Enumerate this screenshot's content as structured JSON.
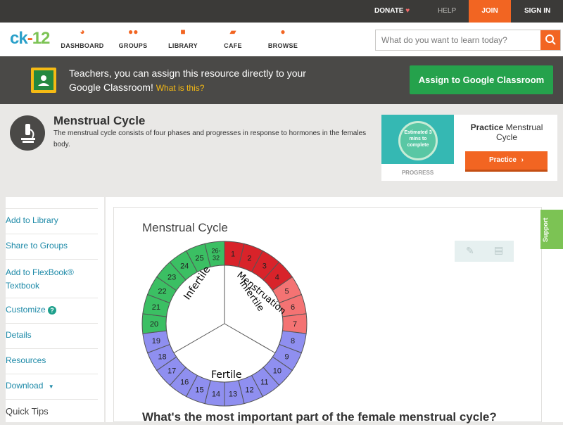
{
  "topbar": {
    "donate": "DONATE",
    "help": "HELP",
    "join": "JOIN",
    "signin": "SIGN IN"
  },
  "logo": {
    "ck": "ck",
    "dash": "-",
    "num": "12"
  },
  "nav": [
    {
      "label": "DASHBOARD",
      "icon": "dashboard-icon"
    },
    {
      "label": "GROUPS",
      "icon": "groups-icon"
    },
    {
      "label": "LIBRARY",
      "icon": "library-icon"
    },
    {
      "label": "CAFE",
      "icon": "cafe-icon"
    },
    {
      "label": "BROWSE",
      "icon": "browse-icon"
    }
  ],
  "search": {
    "placeholder": "What do you want to learn today?"
  },
  "banner": {
    "text": "Teachers, you can assign this resource directly to your Google Classroom!",
    "link": "What is this?",
    "button": "Assign to Google Classroom"
  },
  "concept": {
    "title": "Menstrual Cycle",
    "description": "The menstrual cycle consists of four phases and progresses in response to hormones in the females body."
  },
  "practice": {
    "progress_text": "Estimated 3 mins to complete",
    "progress_label": "PROGRESS",
    "title_bold": "Practice",
    "title_rest": "Menstrual Cycle",
    "button": "Practice"
  },
  "sidebar": {
    "items": [
      "Add to Library",
      "Share to Groups",
      "Add to FlexBook® Textbook",
      "Customize",
      "Details",
      "Resources",
      "Download",
      "Quick Tips"
    ]
  },
  "figure": {
    "title": "Menstrual Cycle",
    "section_labels": [
      "Infertile",
      "Menstruation",
      "Infertile",
      "Fertile"
    ],
    "days": [
      "1",
      "2",
      "3",
      "4",
      "5",
      "6",
      "7",
      "8",
      "9",
      "10",
      "11",
      "12",
      "13",
      "14",
      "15",
      "16",
      "17",
      "18",
      "19",
      "20",
      "21",
      "22",
      "23",
      "24",
      "25",
      "26-32"
    ],
    "colors": {
      "menstruation": "#d8232a",
      "post": "#f47373",
      "fertile": "#8f8ff0",
      "infertile": "#3bbf63"
    }
  },
  "question": "What's the most important part of the female menstrual cycle?",
  "support": "Support",
  "colors": {
    "accent": "#f26522",
    "banner": "#4a4947",
    "green": "#25a24c"
  }
}
